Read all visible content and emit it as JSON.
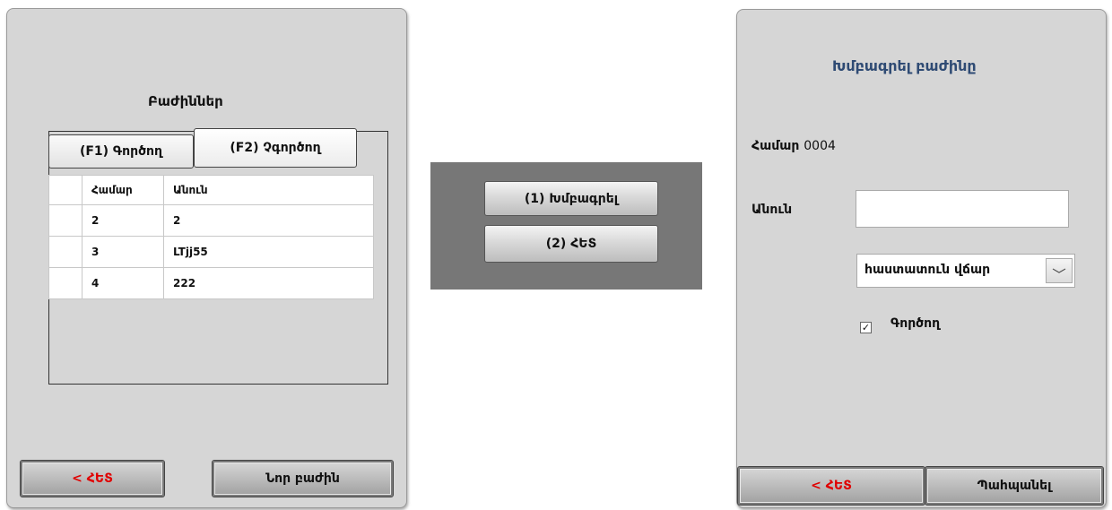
{
  "left_panel": {
    "title": "Բաժիններ",
    "tabs": [
      {
        "label": "(F1) Գործող"
      },
      {
        "label": "(F2) Չգործող"
      }
    ],
    "table": {
      "columns": [
        "",
        "Համար",
        "Անուն"
      ],
      "rows": [
        {
          "number": "2",
          "name": "2"
        },
        {
          "number": "3",
          "name": "LTjj55"
        },
        {
          "number": "4",
          "name": "222"
        }
      ]
    },
    "back_label": "< ՀԵՏ",
    "new_label": "Նոր բաժին"
  },
  "dialog": {
    "edit_label": "(1) Խմբագրել",
    "back_label": "(2) ՀԵՏ"
  },
  "right_panel": {
    "title": "Խմբագրել բաժինը",
    "number_label": "Համար",
    "number_value": "0004",
    "name_label": "Անուն",
    "name_value": "",
    "select_value": "հաստատուն վճար",
    "checkbox_label": "Գործող",
    "checkbox_checked": true,
    "checkbox_mark": "✓",
    "back_label": "< ՀԵՏ",
    "save_label": "Պահպանել"
  },
  "colors": {
    "panel_bg": "#d6d6d6",
    "dialog_bg": "#777777",
    "back_text": "#e00000",
    "title_blue": "#2f4b74"
  }
}
